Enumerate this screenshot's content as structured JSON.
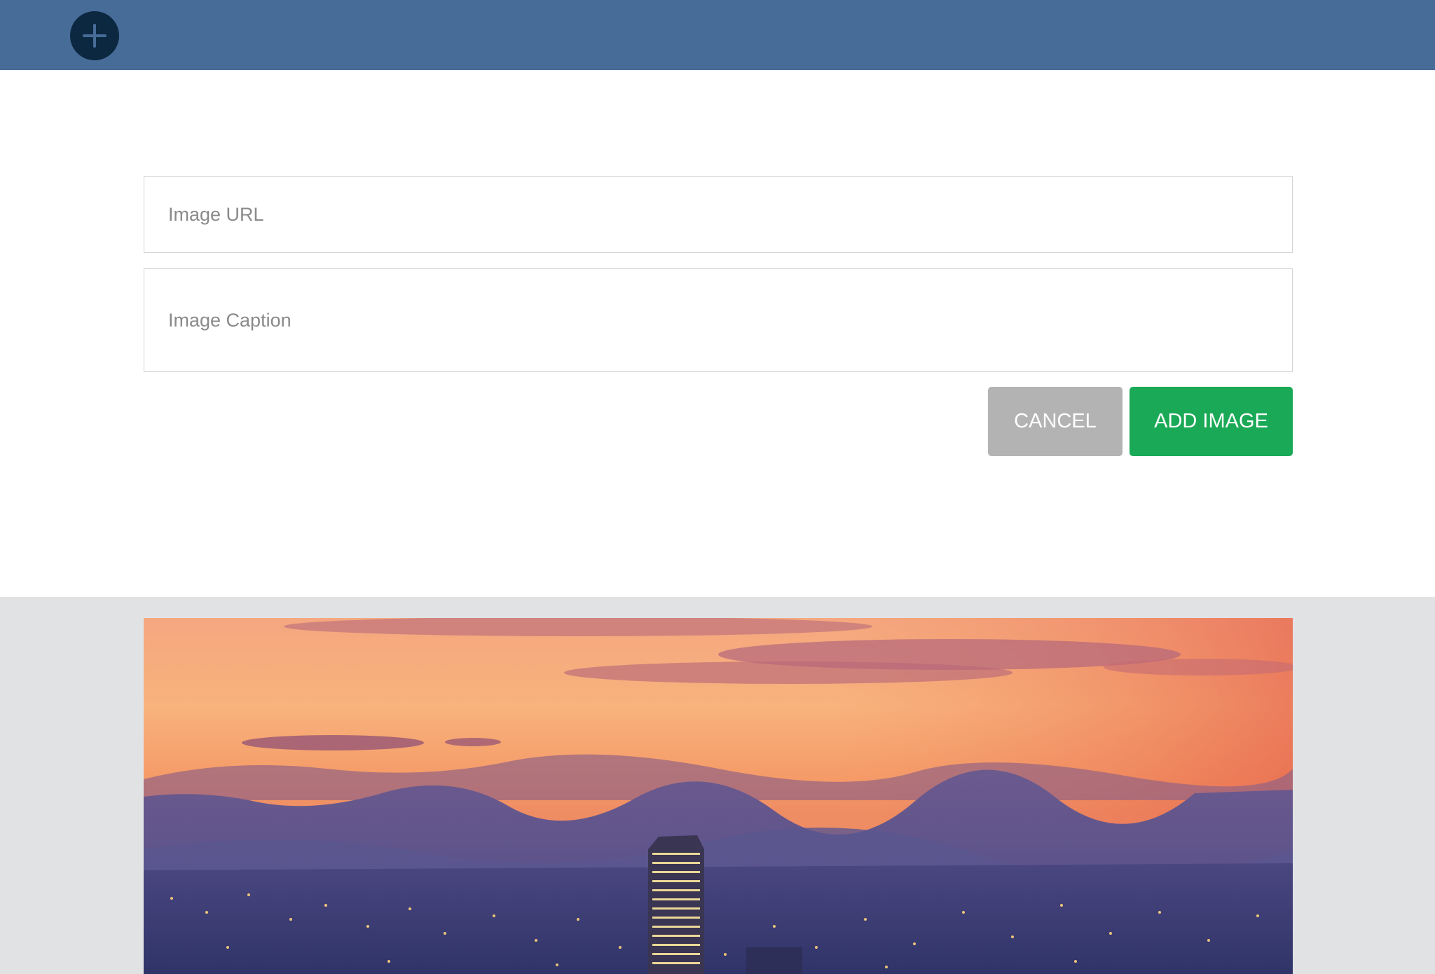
{
  "header": {
    "add_icon": "plus-icon",
    "background_color": "#476c98",
    "fab_color": "#0c2740"
  },
  "form": {
    "url_placeholder": "Image URL",
    "caption_placeholder": "Image Caption",
    "cancel_label": "CANCEL",
    "add_label": "ADD IMAGE",
    "cancel_color": "#b3b3b3",
    "add_color": "#1aa956"
  },
  "gallery": {
    "background_color": "#e1e2e4"
  }
}
